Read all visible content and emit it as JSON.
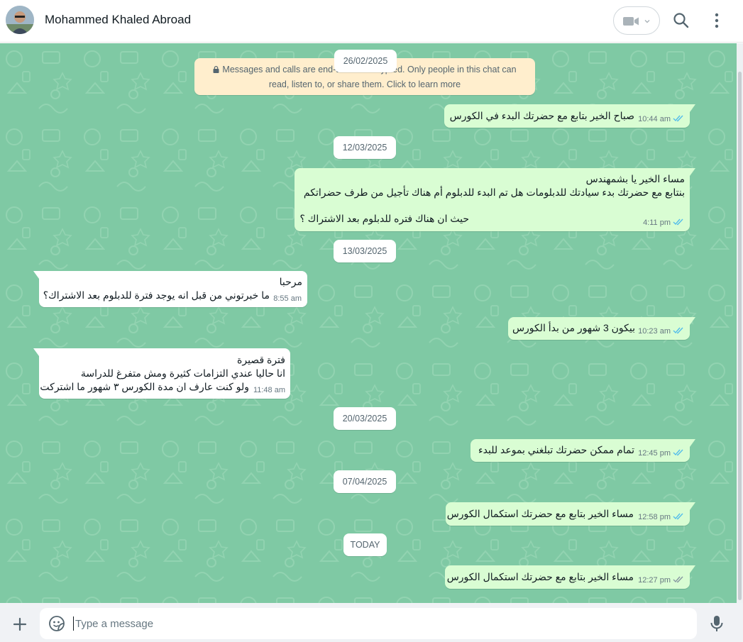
{
  "header": {
    "contact_name": "Mohammed Khaled Abroad"
  },
  "encryption_notice": "Messages and calls are end-to-end encrypted. Only people in this chat can read, listen to, or share them. Click to learn more",
  "dates": [
    "26/02/2025",
    "12/03/2025",
    "13/03/2025",
    "20/03/2025",
    "07/04/2025",
    "TODAY"
  ],
  "messages": [
    {
      "direction": "out",
      "lines": [
        "صباح الخير بتابع مع حضرتك البدء في الكورس"
      ],
      "time": "10:44 am",
      "read": true
    },
    {
      "direction": "out",
      "lines": [
        "مساء الخير يا بشمهندس",
        "بنتابع مع حضرتك بدء سيادتك للدبلومات هل تم البدء للدبلوم أم هناك تأجيل من طرف حضراتكم",
        "",
        "حيث ان هناك فتره للدبلوم بعد الاشتراك ؟"
      ],
      "time": "4:11 pm",
      "read": true
    },
    {
      "direction": "in",
      "lines": [
        "مرحبا",
        "ما خبرتوني من قبل انه يوجد فترة للدبلوم بعد الاشتراك؟"
      ],
      "time": "8:55 am"
    },
    {
      "direction": "out",
      "lines": [
        "بيكون 3 شهور من بدأ الكورس"
      ],
      "time": "10:23 am",
      "read": true
    },
    {
      "direction": "in",
      "lines": [
        "فترة قصيرة",
        "انا حاليا عندي التزامات كثيرة ومش متفرغ للدراسة",
        "ولو كنت عارف ان مدة الكورس ٣ شهور ما اشتركت"
      ],
      "time": "11:48 am"
    },
    {
      "direction": "out",
      "lines": [
        "تمام ممكن حضرتك تبلغني بموعد للبدء"
      ],
      "time": "12:45 pm",
      "read": true
    },
    {
      "direction": "out",
      "lines": [
        "مساء الخير بتابع مع حضرتك استكمال الكورس"
      ],
      "time": "12:58 pm",
      "read": true
    },
    {
      "direction": "out",
      "lines": [
        "مساء الخير بتابع مع حضرتك استكمال الكورس"
      ],
      "time": "12:27 pm",
      "read": false
    }
  ],
  "composer": {
    "placeholder": "Type a message"
  },
  "colors": {
    "chat_background": "#7fc9a4",
    "outgoing_bubble": "#d9fdd3",
    "incoming_bubble": "#ffffff",
    "read_ticks": "#53bdeb",
    "sent_ticks": "#8696a0"
  },
  "icons": [
    "video-call-icon",
    "chevron-down-icon",
    "search-icon",
    "menu-icon",
    "plus-icon",
    "sticker-icon",
    "mic-icon",
    "lock-icon",
    "double-tick-icon"
  ]
}
